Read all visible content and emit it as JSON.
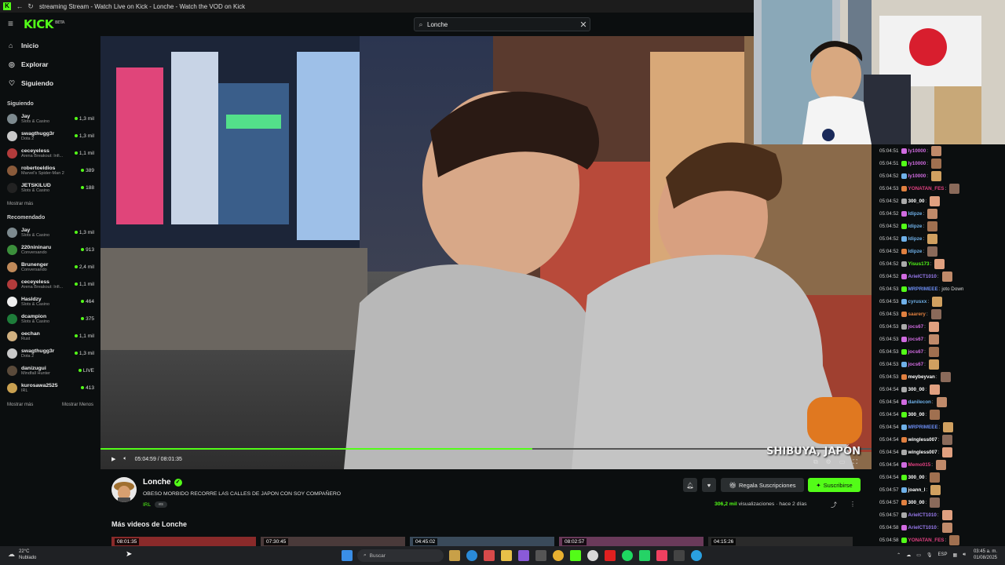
{
  "window": {
    "title": "streaming Stream - Watch Live on Kick - Lonche - Watch the VOD on Kick"
  },
  "header": {
    "logo": "KICK",
    "logo_badge": "BETA",
    "search_value": "Lonche"
  },
  "sidebar": {
    "nav": [
      {
        "icon": "home-icon",
        "label": "Inicio"
      },
      {
        "icon": "compass-icon",
        "label": "Explorar"
      },
      {
        "icon": "heart-icon",
        "label": "Siguiendo"
      }
    ],
    "following_title": "Siguiendo",
    "following": [
      {
        "name": "Jay",
        "category": "Slots & Casino",
        "viewers": "1,3 mil",
        "color": "#7d8a8f"
      },
      {
        "name": "swagthugg3r",
        "category": "Dota 2",
        "viewers": "1,3 mil",
        "color": "#c9c9c9"
      },
      {
        "name": "ceceyeless",
        "category": "Arena Breakout: Infi...",
        "viewers": "1,1 mil",
        "color": "#b23b3b"
      },
      {
        "name": "robertoeldios",
        "category": "Marvel's Spider-Man 2",
        "viewers": "389",
        "color": "#8a5a3a"
      },
      {
        "name": "JETSKILUD",
        "category": "Slots & Casino",
        "viewers": "188",
        "color": "#222"
      }
    ],
    "show_more": "Mostrar más",
    "recommended_title": "Recomendado",
    "recommended": [
      {
        "name": "Jay",
        "category": "Slots & Casino",
        "viewers": "1,3 mil",
        "color": "#7d8a8f"
      },
      {
        "name": "220nininaru",
        "category": "Conversando",
        "viewers": "913",
        "color": "#3b8f3b"
      },
      {
        "name": "Brunenger",
        "category": "Conversando",
        "viewers": "2,4 mil",
        "color": "#c08a5a"
      },
      {
        "name": "ceceyeless",
        "category": "Arena Breakout: Infi...",
        "viewers": "1,1 mil",
        "color": "#b23b3b"
      },
      {
        "name": "Hasldzy",
        "category": "Slots & Casino",
        "viewers": "464",
        "color": "#eeeeee"
      },
      {
        "name": "dcampion",
        "category": "Slots & Casino",
        "viewers": "375",
        "color": "#1e7d3a"
      },
      {
        "name": "oechan",
        "category": "Rust",
        "viewers": "1,1 mil",
        "color": "#d0b080"
      },
      {
        "name": "swagthugg3r",
        "category": "Dota 2",
        "viewers": "1,3 mil",
        "color": "#c9c9c9"
      },
      {
        "name": "danizugui",
        "category": "Mindfall Hunter",
        "viewers": "LIVE",
        "color": "#5a4a3a"
      },
      {
        "name": "kurosawa2525",
        "category": "IRL",
        "viewers": "413",
        "color": "#c9a050"
      }
    ],
    "show_more2": "Mostrar más",
    "show_less": "Mostrar Menos"
  },
  "player": {
    "time": "05:04:59 / 08:01:35",
    "progress": 0.56,
    "watermark": "SHIBUYA, JAPÓN"
  },
  "video_info": {
    "channel": "Lonche",
    "title": "OBESO MORBIDO RECORRE LAS CALLES DE JAPON CON SOY COMPAÑERO",
    "category": "IRL",
    "tag": "es",
    "gift_label": "Regala Suscripciones",
    "subscribe_label": "Suscribirse",
    "views": "306,2 mil",
    "views_label": "visualizaciones",
    "ago": "hace 2 días",
    "more_videos": "Más videos de Lonche",
    "thumbs": [
      "08:01:35",
      "07:30:45",
      "04:45:02",
      "08:02:57",
      "04:15:26"
    ]
  },
  "chat": [
    {
      "t": "05:04:51",
      "u": "ly10000",
      "c": "#d06be0",
      "m": "",
      "e": true
    },
    {
      "t": "05:04:51",
      "u": "ly10000",
      "c": "#d06be0",
      "m": "",
      "e": true
    },
    {
      "t": "05:04:52",
      "u": "ly10000",
      "c": "#d06be0",
      "m": "",
      "e": true
    },
    {
      "t": "05:04:53",
      "u": "YONATAN_FES",
      "c": "#e04080",
      "m": "",
      "e": true
    },
    {
      "t": "05:04:52",
      "u": "300_00",
      "c": "#ffffff",
      "m": "",
      "e": true
    },
    {
      "t": "05:04:52",
      "u": "ldipze",
      "c": "#6fb0e8",
      "m": "",
      "e": true
    },
    {
      "t": "05:04:52",
      "u": "ldipze",
      "c": "#6fb0e8",
      "m": "",
      "e": true
    },
    {
      "t": "05:04:52",
      "u": "ldipze",
      "c": "#6fb0e8",
      "m": "",
      "e": true
    },
    {
      "t": "05:04:52",
      "u": "ldipze",
      "c": "#6fb0e8",
      "m": "",
      "e": true
    },
    {
      "t": "05:04:52",
      "u": "Yisus173",
      "c": "#53fc18",
      "m": "",
      "e": true
    },
    {
      "t": "05:04:52",
      "u": "ArielCT1010",
      "c": "#9a7bf0",
      "m": "",
      "e": true
    },
    {
      "t": "05:04:53",
      "u": "MRPRIMEEE",
      "c": "#6b8cf0",
      "m": "joto Down",
      "e": false
    },
    {
      "t": "05:04:53",
      "u": "cyrusxx",
      "c": "#6fb0e8",
      "m": "",
      "e": true
    },
    {
      "t": "05:04:53",
      "u": "saarery",
      "c": "#e08040",
      "m": "",
      "e": true
    },
    {
      "t": "05:04:53",
      "u": "jocs67",
      "c": "#d06be0",
      "m": "",
      "e": true
    },
    {
      "t": "05:04:53",
      "u": "jocs67",
      "c": "#d06be0",
      "m": "",
      "e": true
    },
    {
      "t": "05:04:53",
      "u": "jocs67",
      "c": "#d06be0",
      "m": "",
      "e": true
    },
    {
      "t": "05:04:53",
      "u": "jocs67",
      "c": "#d06be0",
      "m": "",
      "e": true
    },
    {
      "t": "05:04:53",
      "u": "meybeyvan",
      "c": "#ffffff",
      "m": "",
      "e": true
    },
    {
      "t": "05:04:54",
      "u": "300_00",
      "c": "#ffffff",
      "m": "",
      "e": true
    },
    {
      "t": "05:04:54",
      "u": "danilecon",
      "c": "#6fb0e8",
      "m": "",
      "e": true
    },
    {
      "t": "05:04:54",
      "u": "300_00",
      "c": "#ffffff",
      "m": "",
      "e": true
    },
    {
      "t": "05:04:54",
      "u": "MRPRIMEEE",
      "c": "#6b8cf0",
      "m": "",
      "e": true
    },
    {
      "t": "05:04:54",
      "u": "wingless007",
      "c": "#ffffff",
      "m": "",
      "e": true
    },
    {
      "t": "05:04:54",
      "u": "wingless007",
      "c": "#ffffff",
      "m": "",
      "e": true
    },
    {
      "t": "05:04:54",
      "u": "Memo015",
      "c": "#e04080",
      "m": "",
      "e": true
    },
    {
      "t": "05:04:54",
      "u": "300_00",
      "c": "#ffffff",
      "m": "",
      "e": true
    },
    {
      "t": "05:04:57",
      "u": "joann_l",
      "c": "#ffffff",
      "m": "",
      "e": true
    },
    {
      "t": "05:04:57",
      "u": "300_00",
      "c": "#ffffff",
      "m": "",
      "e": true
    },
    {
      "t": "05:04:57",
      "u": "ArielCT1010",
      "c": "#9a7bf0",
      "m": "",
      "e": true
    },
    {
      "t": "05:04:58",
      "u": "ArielCT1010",
      "c": "#9a7bf0",
      "m": "",
      "e": true
    },
    {
      "t": "05:04:58",
      "u": "YONATAN_FES",
      "c": "#e04080",
      "m": "",
      "e": true
    }
  ],
  "taskbar": {
    "temp": "22°C",
    "weather": "Nublado",
    "search": "Buscar",
    "lang": "ESP",
    "time": "03:45 a. m.",
    "date": "01/08/2025"
  },
  "colors": {
    "accent": "#53fc18",
    "bg": "#0b0e0f"
  }
}
